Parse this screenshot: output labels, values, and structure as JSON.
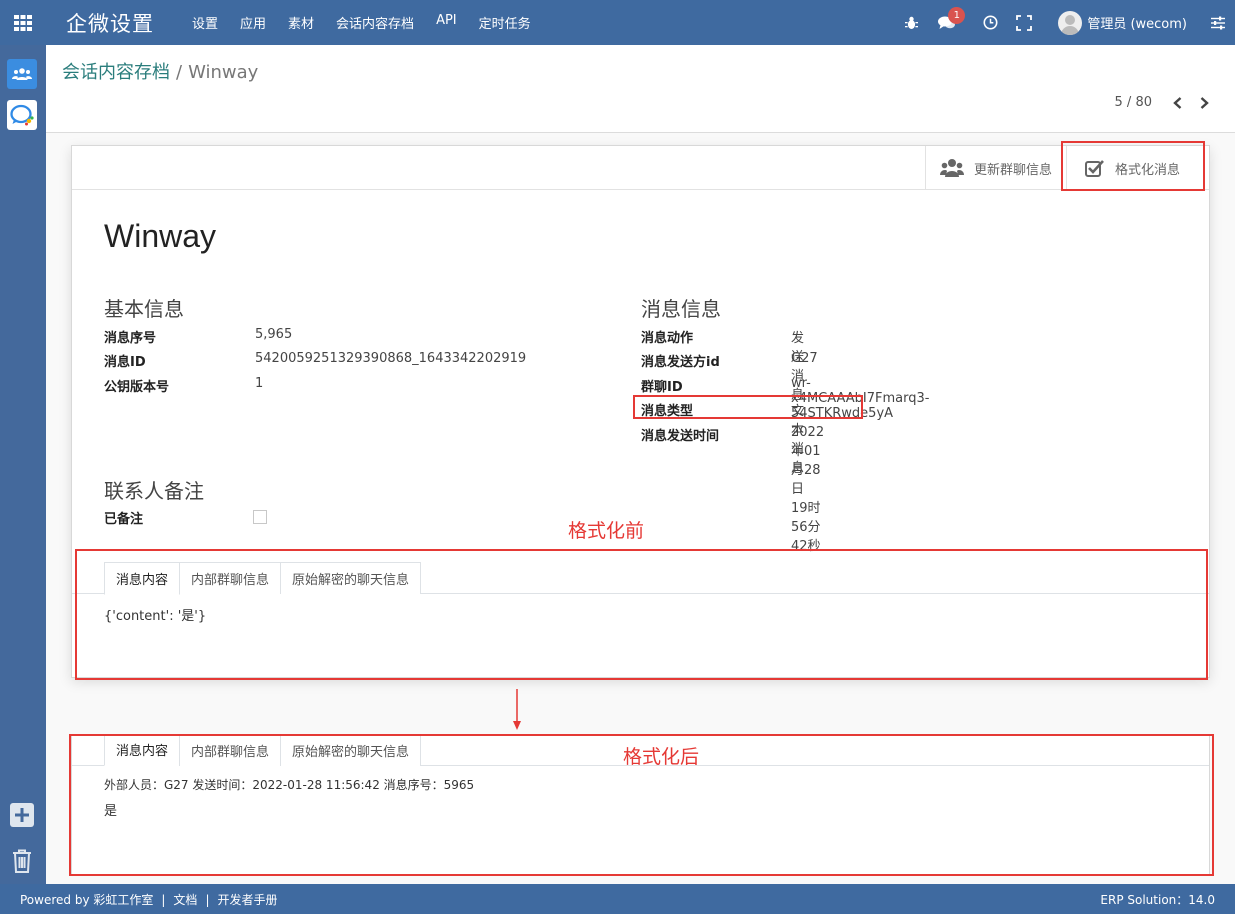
{
  "app": {
    "brand": "企微设置",
    "menu": [
      "设置",
      "应用",
      "素材",
      "会话内容存档",
      "API",
      "定时任务"
    ],
    "notification_count": "1",
    "user": "管理员 (wecom)",
    "accent_color": "#3f6aa0"
  },
  "breadcrumb": {
    "parent": "会话内容存档",
    "separator": "/",
    "current": "Winway"
  },
  "pager": {
    "value": "5 / 80"
  },
  "buttons": {
    "update_group": "更新群聊信息",
    "format_message": "格式化消息"
  },
  "record": {
    "title": "Winway",
    "basic": {
      "heading": "基本信息",
      "fields": [
        {
          "label": "消息序号",
          "value": "5,965"
        },
        {
          "label": "消息ID",
          "value": "5420059251329390868_1643342202919"
        },
        {
          "label": "公钥版本号",
          "value": "1"
        }
      ]
    },
    "message": {
      "heading": "消息信息",
      "fields": [
        {
          "label": "消息动作",
          "value": "发送消息"
        },
        {
          "label": "消息发送方id",
          "value": "G27"
        },
        {
          "label": "群聊ID",
          "value": "wr-x4MCAAAbI7Fmarq3-54STKRwde5yA"
        },
        {
          "label": "消息类型",
          "value": "文本消息"
        },
        {
          "label": "消息发送时间",
          "value": "2022年01月28日 19时56分42秒"
        }
      ]
    },
    "contact": {
      "heading": "联系人备注",
      "remark_label": "已备注",
      "remarked": false
    }
  },
  "tabs": [
    "消息内容",
    "内部群聊信息",
    "原始解密的聊天信息"
  ],
  "before": {
    "annotation": "格式化前",
    "content": "{'content': '是'}"
  },
  "after": {
    "annotation": "格式化后",
    "header_line": "外部人员：G27 发送时间：2022-01-28 11:56:42 消息序号：5965",
    "body_line": "是"
  },
  "footer": {
    "powered_by": "Powered by 彩虹工作室",
    "docs": "文档",
    "dev_manual": "开发者手册",
    "separator": "|",
    "version": "ERP Solution：14.0"
  }
}
